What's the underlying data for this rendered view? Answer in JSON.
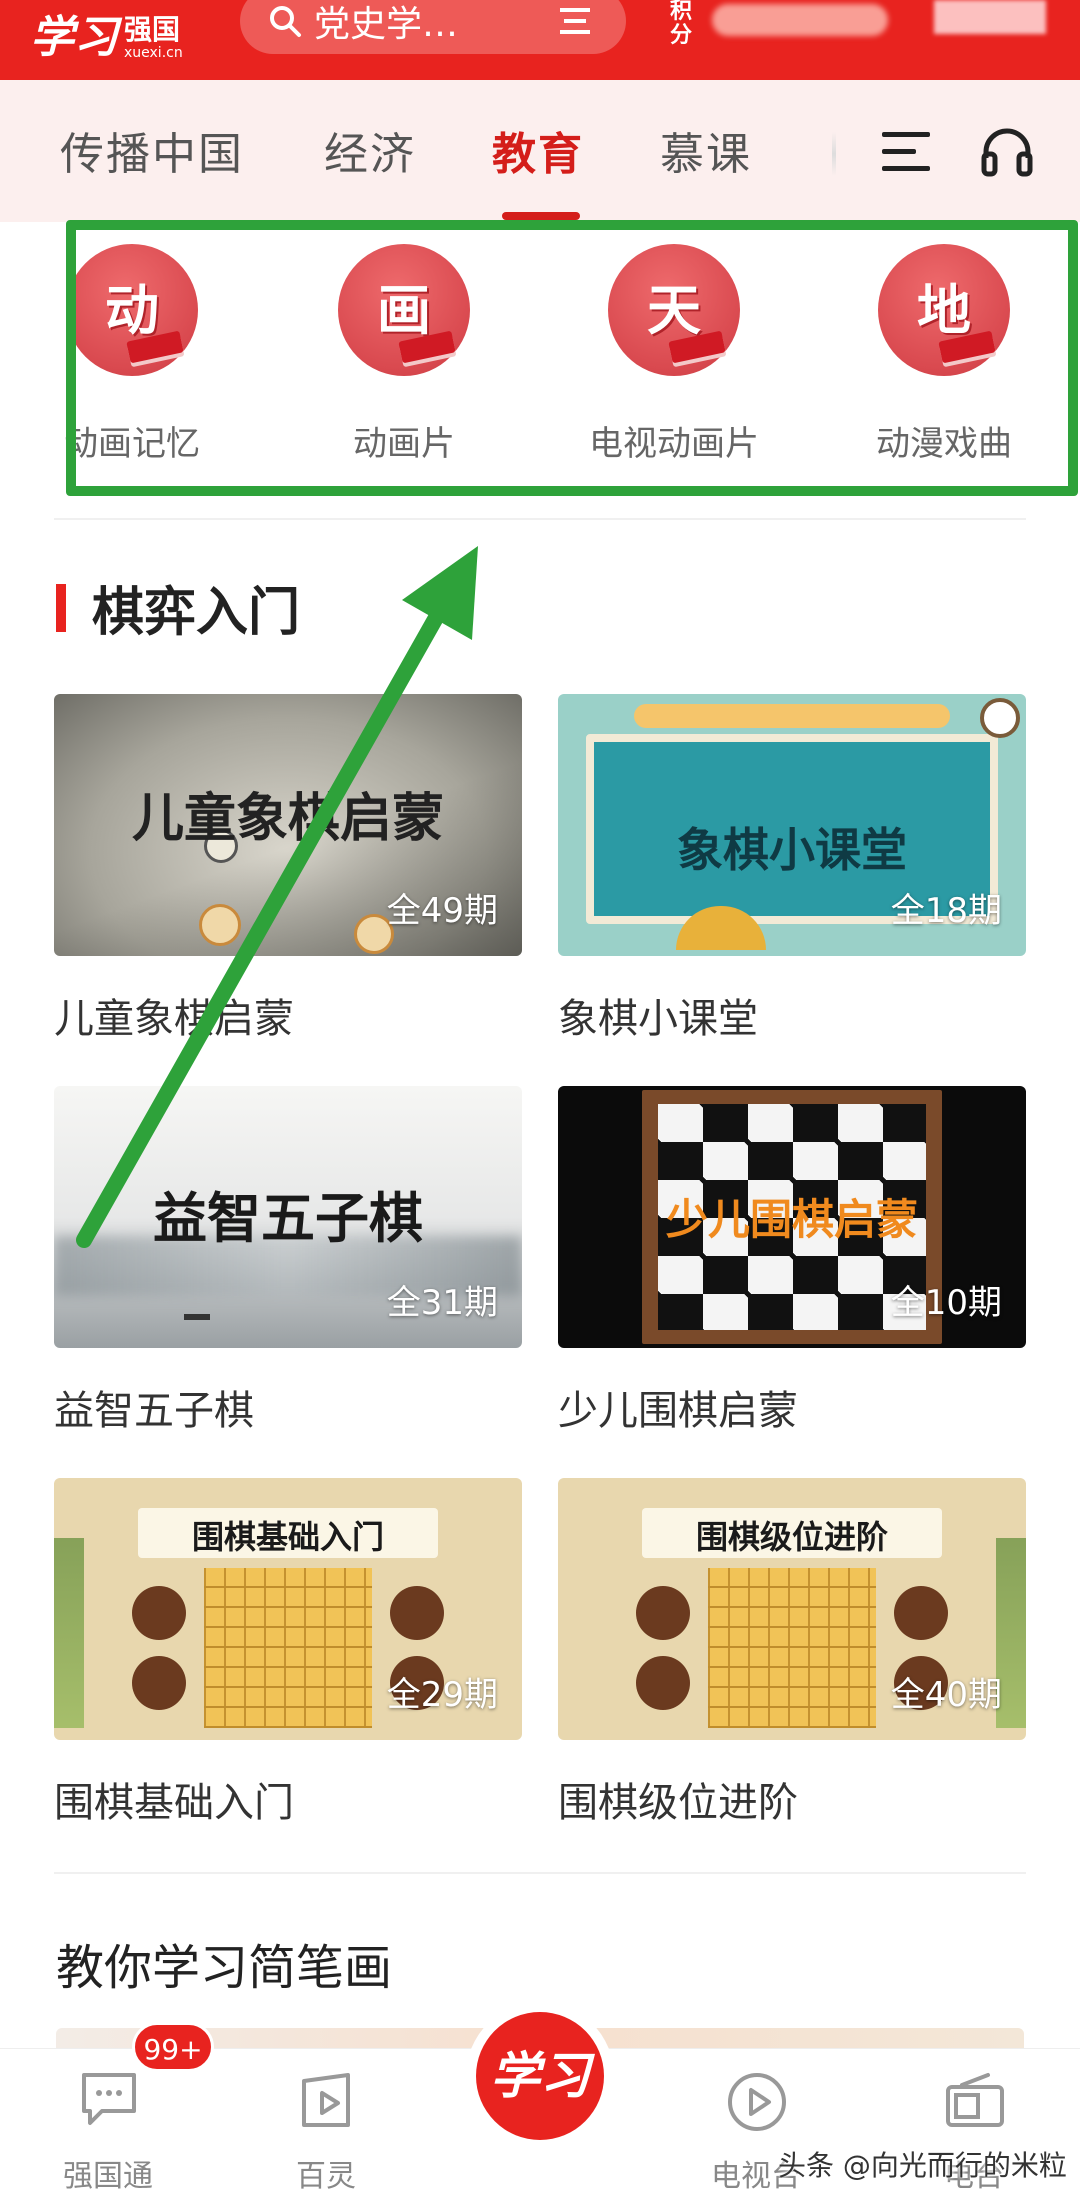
{
  "header": {
    "logo_glyph": "学习",
    "logo_cn": "强国",
    "logo_en": "xuexi.cn",
    "search_placeholder": "党史学…",
    "score_label": "积分"
  },
  "tabs": [
    {
      "label": "传播中国",
      "active": false
    },
    {
      "label": "经济",
      "active": false
    },
    {
      "label": "教育",
      "active": true
    },
    {
      "label": "慕课",
      "active": false
    }
  ],
  "categories": [
    {
      "glyph": "动",
      "label": "动画记忆"
    },
    {
      "glyph": "画",
      "label": "动画片"
    },
    {
      "glyph": "天",
      "label": "电视动画片"
    },
    {
      "glyph": "地",
      "label": "动漫戏曲"
    }
  ],
  "section": {
    "title": "棋弈入门",
    "cards": [
      {
        "title": "儿童象棋启蒙",
        "count": "全49期",
        "art_text": "儿童象棋启蒙"
      },
      {
        "title": "象棋小课堂",
        "count": "全18期",
        "art_text": "象棋小课堂"
      },
      {
        "title": "益智五子棋",
        "count": "全31期",
        "art_text": "益智五子棋"
      },
      {
        "title": "少儿围棋启蒙",
        "count": "全10期",
        "art_text": "少儿围棋启蒙"
      },
      {
        "title": "围棋基础入门",
        "count": "全29期",
        "art_text": "围棋基础入门"
      },
      {
        "title": "围棋级位进阶",
        "count": "全40期",
        "art_text": "围棋级位进阶"
      }
    ]
  },
  "section2": {
    "title": "教你学习简笔画"
  },
  "bottom_nav": {
    "items": [
      {
        "label": "强国通"
      },
      {
        "label": "百灵"
      },
      {
        "label": "电视台"
      },
      {
        "label": "电台"
      }
    ],
    "badge": "99+",
    "center_label": "学习"
  },
  "watermark": "头条 @向光而行的米粒",
  "colors": {
    "brand_red": "#e8231f",
    "highlight_green": "#2ea23a"
  }
}
